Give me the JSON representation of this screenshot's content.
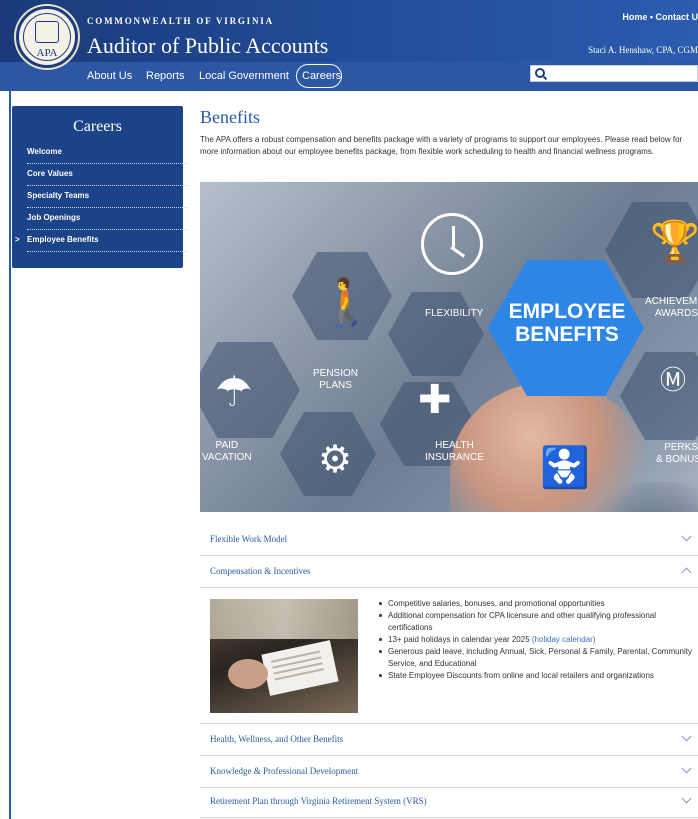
{
  "header": {
    "commonwealth": "COMMONWEALTH OF VIRGINIA",
    "title": "Auditor of Public Accounts",
    "util_links": "Home • Contact U",
    "user": "Staci A. Henshaw, CPA, CGM",
    "seal_text": "APA",
    "nav": [
      "About Us",
      "Reports",
      "Local Government",
      "Careers"
    ],
    "search_placeholder": ""
  },
  "sidebar": {
    "title": "Careers",
    "items": [
      {
        "label": "Welcome",
        "active": false
      },
      {
        "label": "Core Values",
        "active": false
      },
      {
        "label": "Specialty Teams",
        "active": false
      },
      {
        "label": "Job Openings",
        "active": false
      },
      {
        "label": "Employee Benefits",
        "active": true
      }
    ],
    "active_marker": ">"
  },
  "main": {
    "title": "Benefits",
    "intro": "The APA offers a robust compensation and benefits package with a variety of programs to support our employees. Please read below for more information about our employee benefits package, from flexible work scheduling to health and financial wellness programs."
  },
  "hero": {
    "big_line1": "EMPLOYEE",
    "big_line2": "BENEFITS",
    "flexibility": "FLEXIBILITY",
    "pension_line1": "PENSION",
    "pension_line2": "PLANS",
    "health_line1": "HEALTH",
    "health_line2": "INSURANCE",
    "vacation_line1": "PAID",
    "vacation_line2": "VACATION",
    "awards_line1": "ACHIEVEME",
    "awards_line2": "AWARDS",
    "perks_line1": "PERKS",
    "perks_line2": "& BONUS"
  },
  "accordion": [
    {
      "title": "Flexible Work Model",
      "expanded": false
    },
    {
      "title": "Compensation & Incentives",
      "expanded": true
    },
    {
      "title": "Health, Wellness, and Other Benefits",
      "expanded": false
    },
    {
      "title": "Knowledge & Professional Development",
      "expanded": false
    },
    {
      "title": "Retirement Plan through Virginia Retirement System (VRS)",
      "expanded": false
    }
  ],
  "compensation": {
    "bullet1": "Competitive salaries, bonuses, and promotional opportunities",
    "bullet2": "Additional compensation for CPA licensure and other qualifying professional certifications",
    "bullet3_text": "13+ paid holidays in calendar year 2025 ",
    "bullet3_link": "(holiday calendar)",
    "bullet4": "Generous paid leave, including Annual, Sick, Personal & Family, Parental, Community Service, and Educational",
    "bullet5": "State Employee Discounts from online and local retailers and organizations"
  },
  "colors": {
    "header_dark": "#1b3c7d",
    "nav_blue": "#2b57a5",
    "title_blue": "#2a5aa5",
    "link_blue": "#3b73c4",
    "benefits_hex": "#2d86e6"
  }
}
